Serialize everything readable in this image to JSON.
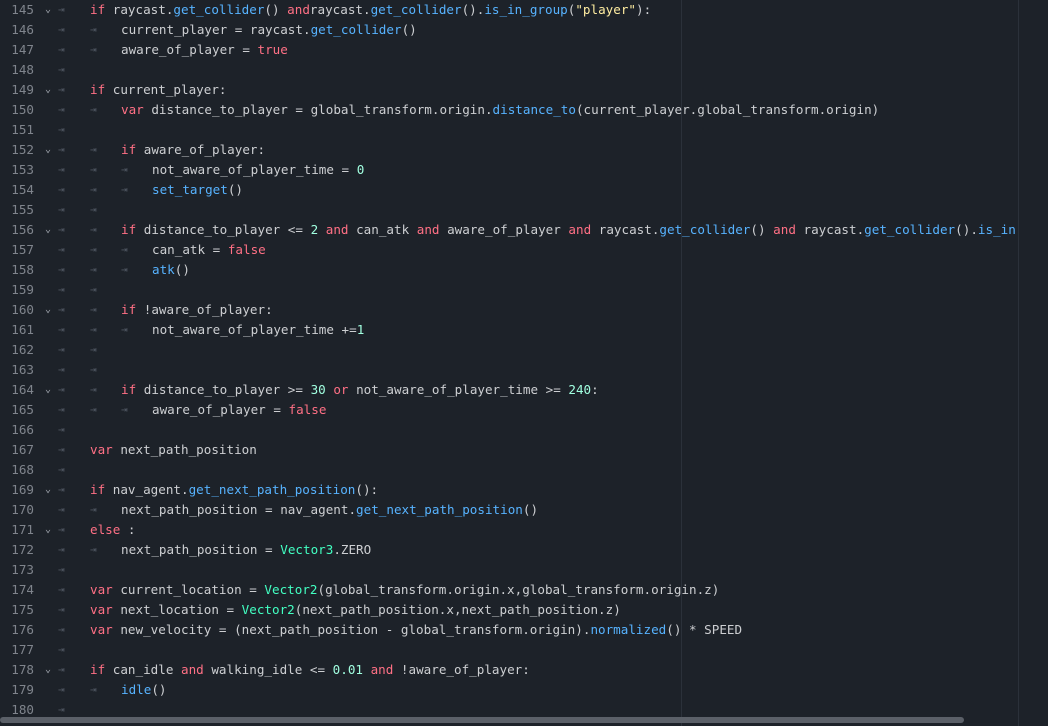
{
  "editor": {
    "lines": [
      {
        "n": "145",
        "fold": true,
        "ind": 0,
        "segs": [
          [
            "kw",
            "if"
          ],
          [
            "",
            "raycast."
          ],
          [
            "fn",
            "get_collider"
          ],
          [
            "",
            "() "
          ],
          [
            "kw",
            "and"
          ],
          [
            "",
            "raycast."
          ],
          [
            "fn",
            "get_collider"
          ],
          [
            "",
            "()."
          ],
          [
            "fn",
            "is_in_group"
          ],
          [
            "",
            "("
          ],
          [
            "str",
            "\"player\""
          ],
          [
            "",
            "):"
          ]
        ]
      },
      {
        "n": "146",
        "fold": false,
        "ind": 1,
        "segs": [
          [
            "",
            "current_player = raycast."
          ],
          [
            "fn",
            "get_collider"
          ],
          [
            "",
            "()"
          ]
        ]
      },
      {
        "n": "147",
        "fold": false,
        "ind": 1,
        "segs": [
          [
            "",
            "aware_of_player = "
          ],
          [
            "bool",
            "true"
          ]
        ]
      },
      {
        "n": "148",
        "fold": false,
        "ind": 0,
        "segs": []
      },
      {
        "n": "149",
        "fold": true,
        "ind": 0,
        "segs": [
          [
            "kw",
            "if"
          ],
          [
            "",
            "current_player:"
          ]
        ]
      },
      {
        "n": "150",
        "fold": false,
        "ind": 1,
        "segs": [
          [
            "kw",
            "var"
          ],
          [
            "",
            "distance_to_player = global_transform.origin."
          ],
          [
            "fn",
            "distance_to"
          ],
          [
            "",
            "(current_player.global_transform.origin)"
          ]
        ]
      },
      {
        "n": "151",
        "fold": false,
        "ind": 0,
        "segs": []
      },
      {
        "n": "152",
        "fold": true,
        "ind": 1,
        "segs": [
          [
            "kw",
            "if"
          ],
          [
            "",
            "aware_of_player:"
          ]
        ]
      },
      {
        "n": "153",
        "fold": false,
        "ind": 2,
        "segs": [
          [
            "",
            "not_aware_of_player_time = "
          ],
          [
            "num",
            "0"
          ]
        ]
      },
      {
        "n": "154",
        "fold": false,
        "ind": 2,
        "segs": [
          [
            "fn",
            "set_target"
          ],
          [
            "",
            "()"
          ]
        ]
      },
      {
        "n": "155",
        "fold": false,
        "ind": 1,
        "segs": []
      },
      {
        "n": "156",
        "fold": true,
        "ind": 1,
        "segs": [
          [
            "kw",
            "if"
          ],
          [
            "",
            "distance_to_player <= "
          ],
          [
            "num",
            "2"
          ],
          [
            "",
            " "
          ],
          [
            "kw",
            "and"
          ],
          [
            "",
            " can_atk "
          ],
          [
            "kw",
            "and"
          ],
          [
            "",
            " aware_of_player "
          ],
          [
            "kw",
            "and"
          ],
          [
            "",
            " raycast."
          ],
          [
            "fn",
            "get_collider"
          ],
          [
            "",
            "() "
          ],
          [
            "kw",
            "and"
          ],
          [
            "",
            " raycast."
          ],
          [
            "fn",
            "get_collider"
          ],
          [
            "",
            "()."
          ],
          [
            "fn",
            "is_in"
          ]
        ]
      },
      {
        "n": "157",
        "fold": false,
        "ind": 2,
        "segs": [
          [
            "",
            "can_atk = "
          ],
          [
            "bool",
            "false"
          ]
        ]
      },
      {
        "n": "158",
        "fold": false,
        "ind": 2,
        "segs": [
          [
            "fn",
            "atk"
          ],
          [
            "",
            "()"
          ]
        ]
      },
      {
        "n": "159",
        "fold": false,
        "ind": 1,
        "segs": []
      },
      {
        "n": "160",
        "fold": true,
        "ind": 1,
        "segs": [
          [
            "kw",
            "if"
          ],
          [
            "",
            "!aware_of_player:"
          ]
        ]
      },
      {
        "n": "161",
        "fold": false,
        "ind": 2,
        "segs": [
          [
            "",
            "not_aware_of_player_time +="
          ],
          [
            "num",
            "1"
          ]
        ]
      },
      {
        "n": "162",
        "fold": false,
        "ind": 1,
        "segs": []
      },
      {
        "n": "163",
        "fold": false,
        "ind": 1,
        "segs": []
      },
      {
        "n": "164",
        "fold": true,
        "ind": 1,
        "segs": [
          [
            "kw",
            "if"
          ],
          [
            "",
            "distance_to_player >= "
          ],
          [
            "num",
            "30"
          ],
          [
            "",
            " "
          ],
          [
            "kw",
            "or"
          ],
          [
            "",
            " not_aware_of_player_time >= "
          ],
          [
            "num",
            "240"
          ],
          [
            "",
            ":"
          ]
        ]
      },
      {
        "n": "165",
        "fold": false,
        "ind": 2,
        "segs": [
          [
            "",
            "aware_of_player = "
          ],
          [
            "bool",
            "false"
          ]
        ]
      },
      {
        "n": "166",
        "fold": false,
        "ind": 0,
        "segs": []
      },
      {
        "n": "167",
        "fold": false,
        "ind": 0,
        "segs": [
          [
            "kw",
            "var"
          ],
          [
            "",
            "next_path_position"
          ]
        ]
      },
      {
        "n": "168",
        "fold": false,
        "ind": 0,
        "segs": []
      },
      {
        "n": "169",
        "fold": true,
        "ind": 0,
        "segs": [
          [
            "kw",
            "if"
          ],
          [
            "",
            "nav_agent."
          ],
          [
            "fn",
            "get_next_path_position"
          ],
          [
            "",
            "():"
          ]
        ]
      },
      {
        "n": "170",
        "fold": false,
        "ind": 1,
        "segs": [
          [
            "",
            "next_path_position = nav_agent."
          ],
          [
            "fn",
            "get_next_path_position"
          ],
          [
            "",
            "()"
          ]
        ]
      },
      {
        "n": "171",
        "fold": true,
        "ind": 0,
        "segs": [
          [
            "kw",
            "else"
          ],
          [
            "",
            ":"
          ]
        ]
      },
      {
        "n": "172",
        "fold": false,
        "ind": 1,
        "segs": [
          [
            "",
            "next_path_position = "
          ],
          [
            "ty",
            "Vector3"
          ],
          [
            "",
            ".ZERO"
          ]
        ]
      },
      {
        "n": "173",
        "fold": false,
        "ind": 0,
        "segs": []
      },
      {
        "n": "174",
        "fold": false,
        "ind": 0,
        "segs": [
          [
            "kw",
            "var"
          ],
          [
            "",
            "current_location = "
          ],
          [
            "ty",
            "Vector2"
          ],
          [
            "",
            "(global_transform.origin.x,global_transform.origin.z)"
          ]
        ]
      },
      {
        "n": "175",
        "fold": false,
        "ind": 0,
        "segs": [
          [
            "kw",
            "var"
          ],
          [
            "",
            "next_location = "
          ],
          [
            "ty",
            "Vector2"
          ],
          [
            "",
            "(next_path_position.x,next_path_position.z)"
          ]
        ]
      },
      {
        "n": "176",
        "fold": false,
        "ind": 0,
        "segs": [
          [
            "kw",
            "var"
          ],
          [
            "",
            "new_velocity = (next_path_position - global_transform.origin)."
          ],
          [
            "fn",
            "normalized"
          ],
          [
            "",
            "() * SPEED"
          ]
        ]
      },
      {
        "n": "177",
        "fold": false,
        "ind": 0,
        "segs": []
      },
      {
        "n": "178",
        "fold": true,
        "ind": 0,
        "segs": [
          [
            "kw",
            "if"
          ],
          [
            "",
            "can_idle "
          ],
          [
            "kw",
            "and"
          ],
          [
            "",
            " walking_idle <= "
          ],
          [
            "num",
            "0.01"
          ],
          [
            "",
            " "
          ],
          [
            "kw",
            "and"
          ],
          [
            "",
            " !aware_of_player:"
          ]
        ]
      },
      {
        "n": "179",
        "fold": false,
        "ind": 1,
        "segs": [
          [
            "fn",
            "idle"
          ],
          [
            "",
            "()"
          ]
        ]
      },
      {
        "n": "180",
        "fold": false,
        "ind": 0,
        "segs": []
      }
    ]
  },
  "icons": {
    "fold": "chevron-down-icon",
    "tab": "tab-indent-icon"
  },
  "glyphs": {
    "fold": "⌄",
    "tab": "⇥"
  },
  "colors": {
    "background": "#1d2229",
    "keyword": "#ff7085",
    "function": "#57b3ff",
    "string": "#ffeda1",
    "number": "#a1ffe0",
    "type": "#42ffc2",
    "text": "#cdcfd2",
    "line_number": "#7f848c"
  }
}
